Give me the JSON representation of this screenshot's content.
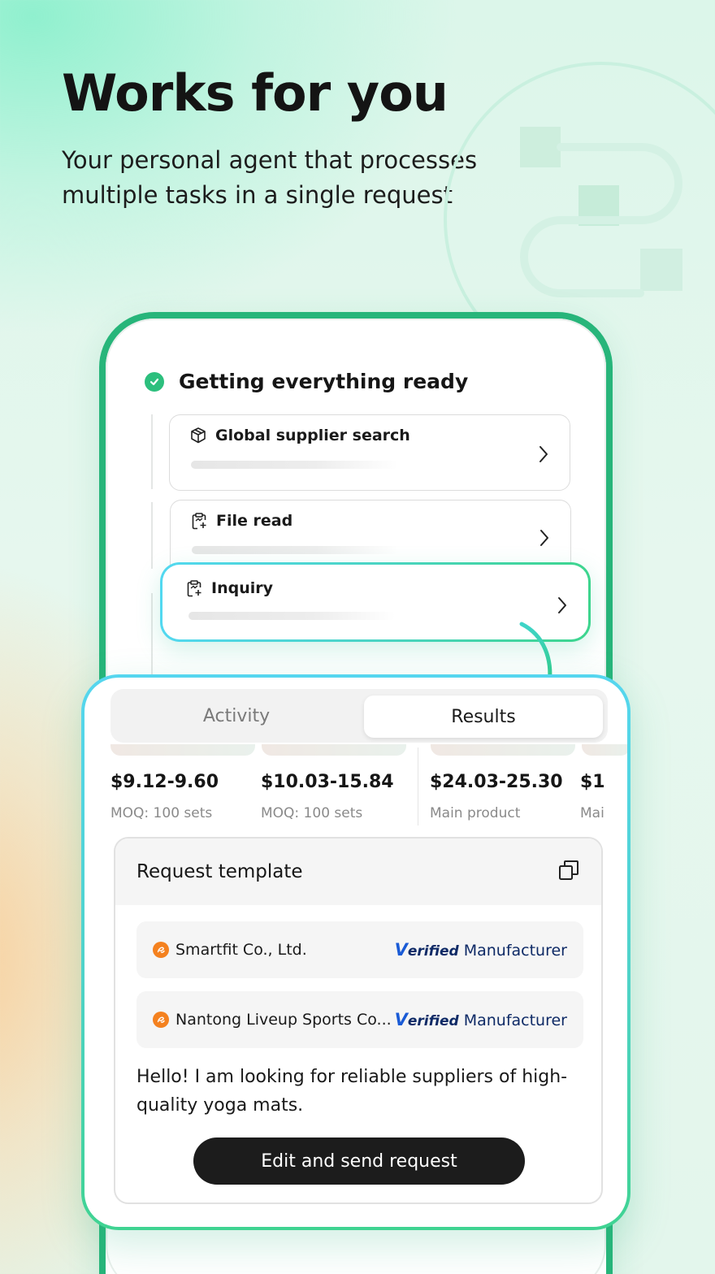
{
  "hero": {
    "title": "Works for you",
    "subtitle": "Your personal agent that processes multiple tasks in a single request"
  },
  "status": {
    "title": "Getting everything ready"
  },
  "tasks": [
    {
      "label": "Global supplier search",
      "icon": "cube-icon"
    },
    {
      "label": "File read",
      "icon": "clipboard-sparkle-icon"
    },
    {
      "label": "Inquiry",
      "icon": "clipboard-sparkle-icon"
    }
  ],
  "tabs": {
    "activity": "Activity",
    "results": "Results",
    "selected": "Results"
  },
  "products": [
    {
      "price": "$9.12-9.60",
      "detail": "MOQ: 100 sets"
    },
    {
      "price": "$10.03-15.84",
      "detail": "MOQ: 100 sets"
    },
    {
      "price": "$24.03-25.30",
      "detail": "Main product"
    },
    {
      "price": "$1",
      "detail": "Mai"
    }
  ],
  "template": {
    "title": "Request template",
    "suppliers": [
      {
        "name": "Smartfit Co., Ltd.",
        "badge_v": "V",
        "badge_rest": "erified",
        "badge_type": "Manufacturer"
      },
      {
        "name": "Nantong Liveup Sports Co...",
        "badge_v": "V",
        "badge_rest": "erified",
        "badge_type": "Manufacturer"
      }
    ],
    "message": "Hello! I am looking for reliable suppliers of high-quality yoga mats.",
    "send_label": "Edit and send request"
  },
  "colors": {
    "accent_green": "#27b57a",
    "accent_cyan": "#52d8f0",
    "verified_blue": "#0e2a66",
    "alibaba_orange": "#f4811f"
  }
}
